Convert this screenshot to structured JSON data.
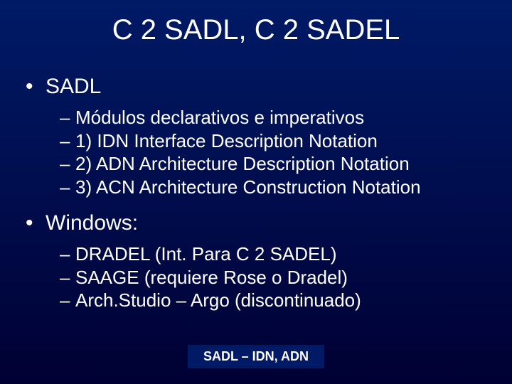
{
  "title": "C 2 SADL, C 2 SADEL",
  "sections": [
    {
      "heading": "SADL",
      "items": [
        "Módulos declarativos e imperativos",
        "1) IDN Interface Description Notation",
        "2) ADN Architecture Description Notation",
        "3) ACN Architecture Construction Notation"
      ]
    },
    {
      "heading": "Windows:",
      "items": [
        "DRADEL (Int. Para C 2 SADEL)",
        "SAAGE (requiere Rose o Dradel)",
        "Arch.Studio – Argo (discontinuado)"
      ]
    }
  ],
  "footer": "SADL – IDN, ADN"
}
